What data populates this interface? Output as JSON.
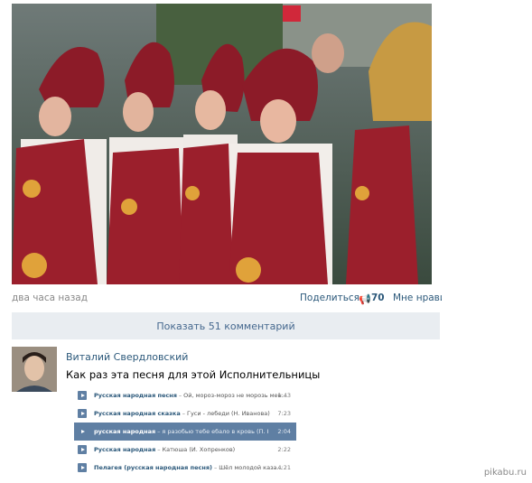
{
  "post": {
    "time": "два часа назад",
    "share_label": "Поделиться",
    "share_icon": "megaphone-icon",
    "share_count": "70",
    "like_label": "Мне нравится"
  },
  "comments_bar": {
    "label": "Показать 51 комментарий"
  },
  "comment": {
    "author": "Виталий Свердловский",
    "text": "Как раз эта песня для этой Исполнительницы"
  },
  "audio": [
    {
      "artist": "Русская народная песня",
      "title": "Ой, мороз-мороз не морозь мен...",
      "duration": "1:43",
      "active": false
    },
    {
      "artist": "Русская народная сказка",
      "title": "Гуси - лебеди (Н. Иванова)",
      "duration": "7:23",
      "active": false
    },
    {
      "artist": "русская народная",
      "title": "я разобью тебе ебало в кровь (П. Кон...",
      "duration": "2:04",
      "active": true
    },
    {
      "artist": "Русская народная",
      "title": "Катюша (И. Хопренков)",
      "duration": "2:22",
      "active": false
    },
    {
      "artist": "Пелагея (русская народная песня)",
      "title": "Шёл молодой каза...",
      "duration": "4:21",
      "active": false
    }
  ],
  "watermark": "pikabu.ru",
  "colors": {
    "link": "#2b587a",
    "bar": "#e9edf1",
    "active_track": "#5f7fa3"
  }
}
